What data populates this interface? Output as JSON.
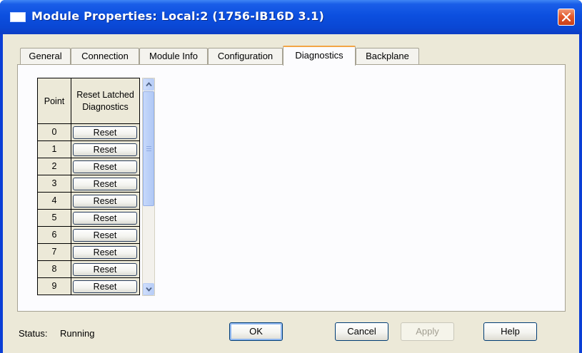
{
  "window": {
    "title": "Module Properties: Local:2 (1756-IB16D 3.1)"
  },
  "tabs": [
    {
      "label": "General"
    },
    {
      "label": "Connection"
    },
    {
      "label": "Module Info"
    },
    {
      "label": "Configuration"
    },
    {
      "label": "Diagnostics",
      "active": true
    },
    {
      "label": "Backplane"
    }
  ],
  "grid": {
    "header_point": "Point",
    "header_reset": "Reset Latched Diagnostics",
    "rows": [
      {
        "point": "0",
        "button": "Reset"
      },
      {
        "point": "1",
        "button": "Reset"
      },
      {
        "point": "2",
        "button": "Reset"
      },
      {
        "point": "3",
        "button": "Reset"
      },
      {
        "point": "4",
        "button": "Reset"
      },
      {
        "point": "5",
        "button": "Reset"
      },
      {
        "point": "6",
        "button": "Reset"
      },
      {
        "point": "7",
        "button": "Reset"
      },
      {
        "point": "8",
        "button": "Reset"
      },
      {
        "point": "9",
        "button": "Reset"
      }
    ]
  },
  "status": {
    "label": "Status:",
    "value": "Running"
  },
  "buttons": {
    "ok": "OK",
    "cancel": "Cancel",
    "apply": "Apply",
    "help": "Help"
  },
  "colors": {
    "title_bar": "#0c4fdf",
    "close_button": "#e35a2c",
    "dialog_face": "#ece9d8",
    "active_tab_accent": "#f3a545",
    "scrollbar": "#b7cdf7"
  }
}
